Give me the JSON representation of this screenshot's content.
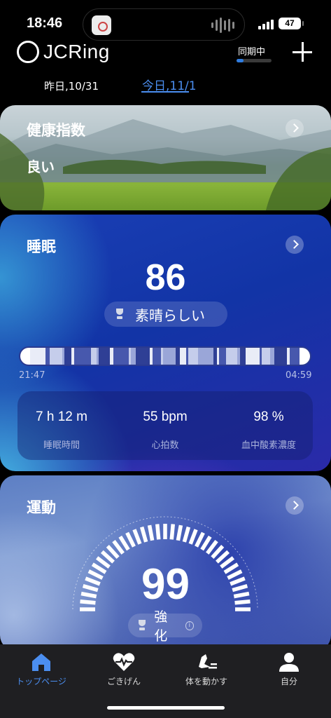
{
  "status_bar": {
    "time": "18:46",
    "battery": "47"
  },
  "header": {
    "app_name": "JCRing",
    "sync_label": "同期中",
    "sync_progress": 0.2
  },
  "dates": {
    "previous": "昨日,10/31",
    "today": "今日,11/1"
  },
  "health_card": {
    "title": "健康指数",
    "status": "良い"
  },
  "sleep_card": {
    "title": "睡眠",
    "score": "86",
    "rating": "素晴らしい",
    "start_time": "21:47",
    "end_time": "04:59",
    "stats": [
      {
        "value": "7 h 12 m",
        "label": "睡眠時間"
      },
      {
        "value": "55 bpm",
        "label": "心拍数"
      },
      {
        "value": "98 %",
        "label": "血中酸素濃度"
      }
    ]
  },
  "activity_card": {
    "title": "運動",
    "score": "99",
    "rating": "強化"
  },
  "tabbar": {
    "items": [
      {
        "label": "トップページ",
        "icon": "home-icon",
        "active": true
      },
      {
        "label": "ごきげん",
        "icon": "heart-pulse-icon",
        "active": false
      },
      {
        "label": "体を動かす",
        "icon": "running-shoe-icon",
        "active": false
      },
      {
        "label": "自分",
        "icon": "person-icon",
        "active": false
      }
    ]
  },
  "colors": {
    "accent": "#4b8ef0"
  }
}
